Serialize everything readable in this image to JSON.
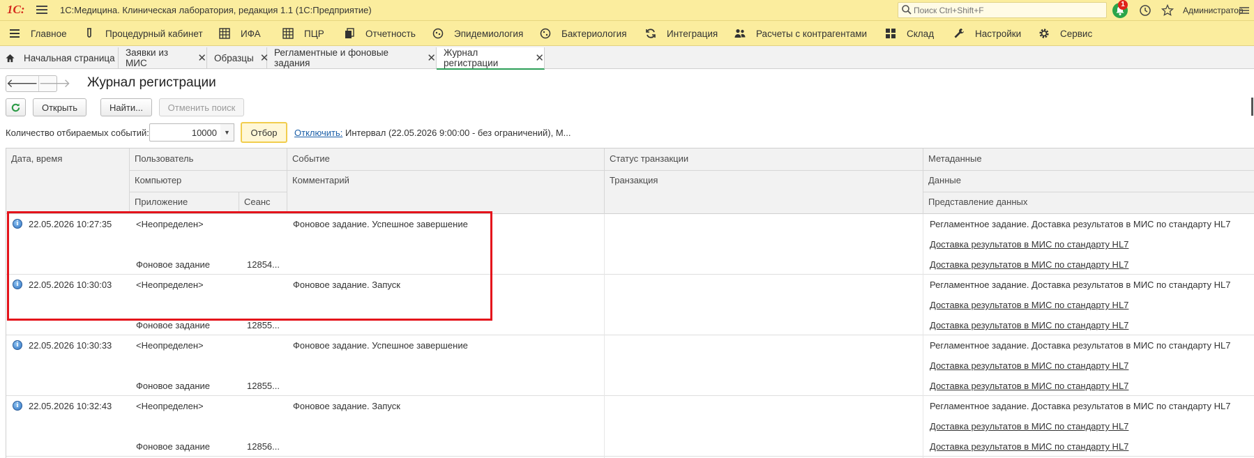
{
  "titlebar": {
    "logo": "1С:",
    "title": "1С:Медицина. Клиническая лаборатория, редакция 1.1  (1С:Предприятие)",
    "search_placeholder": "Поиск Ctrl+Shift+F",
    "notifications_count": "1",
    "user": "Администратор",
    "icons": [
      "menu-icon",
      "search-icon",
      "bell-icon",
      "history-icon",
      "star-icon",
      "settings-icon"
    ]
  },
  "main_menu": [
    {
      "label": "Главное",
      "icon": "menu-icon"
    },
    {
      "label": "Процедурный кабинет",
      "icon": "test-tube-icon"
    },
    {
      "label": "ИФА",
      "icon": "grid-icon"
    },
    {
      "label": "ПЦР",
      "icon": "grid-icon"
    },
    {
      "label": "Отчетность",
      "icon": "documents-icon"
    },
    {
      "label": "Эпидемиология",
      "icon": "virus-icon"
    },
    {
      "label": "Бактериология",
      "icon": "bacteria-icon"
    },
    {
      "label": "Интеграция",
      "icon": "sync-icon"
    },
    {
      "label": "Расчеты с контрагентами",
      "icon": "people-icon"
    },
    {
      "label": "Склад",
      "icon": "warehouse-icon"
    },
    {
      "label": "Настройки",
      "icon": "wrench-icon"
    },
    {
      "label": "Сервис",
      "icon": "gear-icon"
    }
  ],
  "tabs": [
    {
      "label": "Начальная страница",
      "icon": "home-icon"
    },
    {
      "label": "Заявки из МИС"
    },
    {
      "label": "Образцы"
    },
    {
      "label": "Регламентные и фоновые задания"
    },
    {
      "label": "Журнал регистрации",
      "active": true
    }
  ],
  "page": {
    "title": "Журнал регистрации",
    "buttons": {
      "open": "Открыть",
      "find": "Найти...",
      "cancel_search": "Отменить поиск",
      "filter": "Отбор"
    },
    "count_label": "Количество отбираемых событий:",
    "count_value": "10000",
    "disable_link": "Отключить:",
    "interval_text": "Интервал (22.05.2026 9:00:00 - без ограничений), М..."
  },
  "grid": {
    "headers": {
      "datetime": "Дата, время",
      "user": "Пользователь",
      "computer": "Компьютер",
      "application": "Приложение",
      "session": "Сеанс",
      "event": "Событие",
      "comment": "Комментарий",
      "tx_status": "Статус транзакции",
      "transaction": "Транзакция",
      "metadata": "Метаданные",
      "data": "Данные",
      "data_repr": "Представление данных"
    },
    "rows": [
      {
        "datetime": "22.05.2026 10:27:35",
        "user": "<Неопределен>",
        "application": "Фоновое задание",
        "session": "12854...",
        "event": "Фоновое задание. Успешное завершение",
        "metadata": "Регламентное задание. Доставка результатов в МИС по стандарту HL7",
        "data": "Доставка результатов в МИС по стандарту HL7",
        "data_repr": "Доставка результатов в МИС по стандарту HL7"
      },
      {
        "datetime": "22.05.2026 10:30:03",
        "user": "<Неопределен>",
        "application": "Фоновое задание",
        "session": "12855...",
        "event": "Фоновое задание. Запуск",
        "metadata": "Регламентное задание. Доставка результатов в МИС по стандарту HL7",
        "data": "Доставка результатов в МИС по стандарту HL7",
        "data_repr": "Доставка результатов в МИС по стандарту HL7"
      },
      {
        "datetime": "22.05.2026 10:30:33",
        "user": "<Неопределен>",
        "application": "Фоновое задание",
        "session": "12855...",
        "event": "Фоновое задание. Успешное завершение",
        "metadata": "Регламентное задание. Доставка результатов в МИС по стандарту HL7",
        "data": "Доставка результатов в МИС по стандарту HL7",
        "data_repr": "Доставка результатов в МИС по стандарту HL7"
      },
      {
        "datetime": "22.05.2026 10:32:43",
        "user": "<Неопределен>",
        "application": "Фоновое задание",
        "session": "12856...",
        "event": "Фоновое задание. Запуск",
        "metadata": "Регламентное задание. Доставка результатов в МИС по стандарту HL7",
        "data": "Доставка результатов в МИС по стандарту HL7",
        "data_repr": "Доставка результатов в МИС по стандарту HL7"
      }
    ]
  },
  "colors": {
    "topbar": "#fbed9e",
    "highlight": "#e4131b",
    "active_tab_underline": "#2c9e57",
    "link": "#1b5fa8"
  }
}
